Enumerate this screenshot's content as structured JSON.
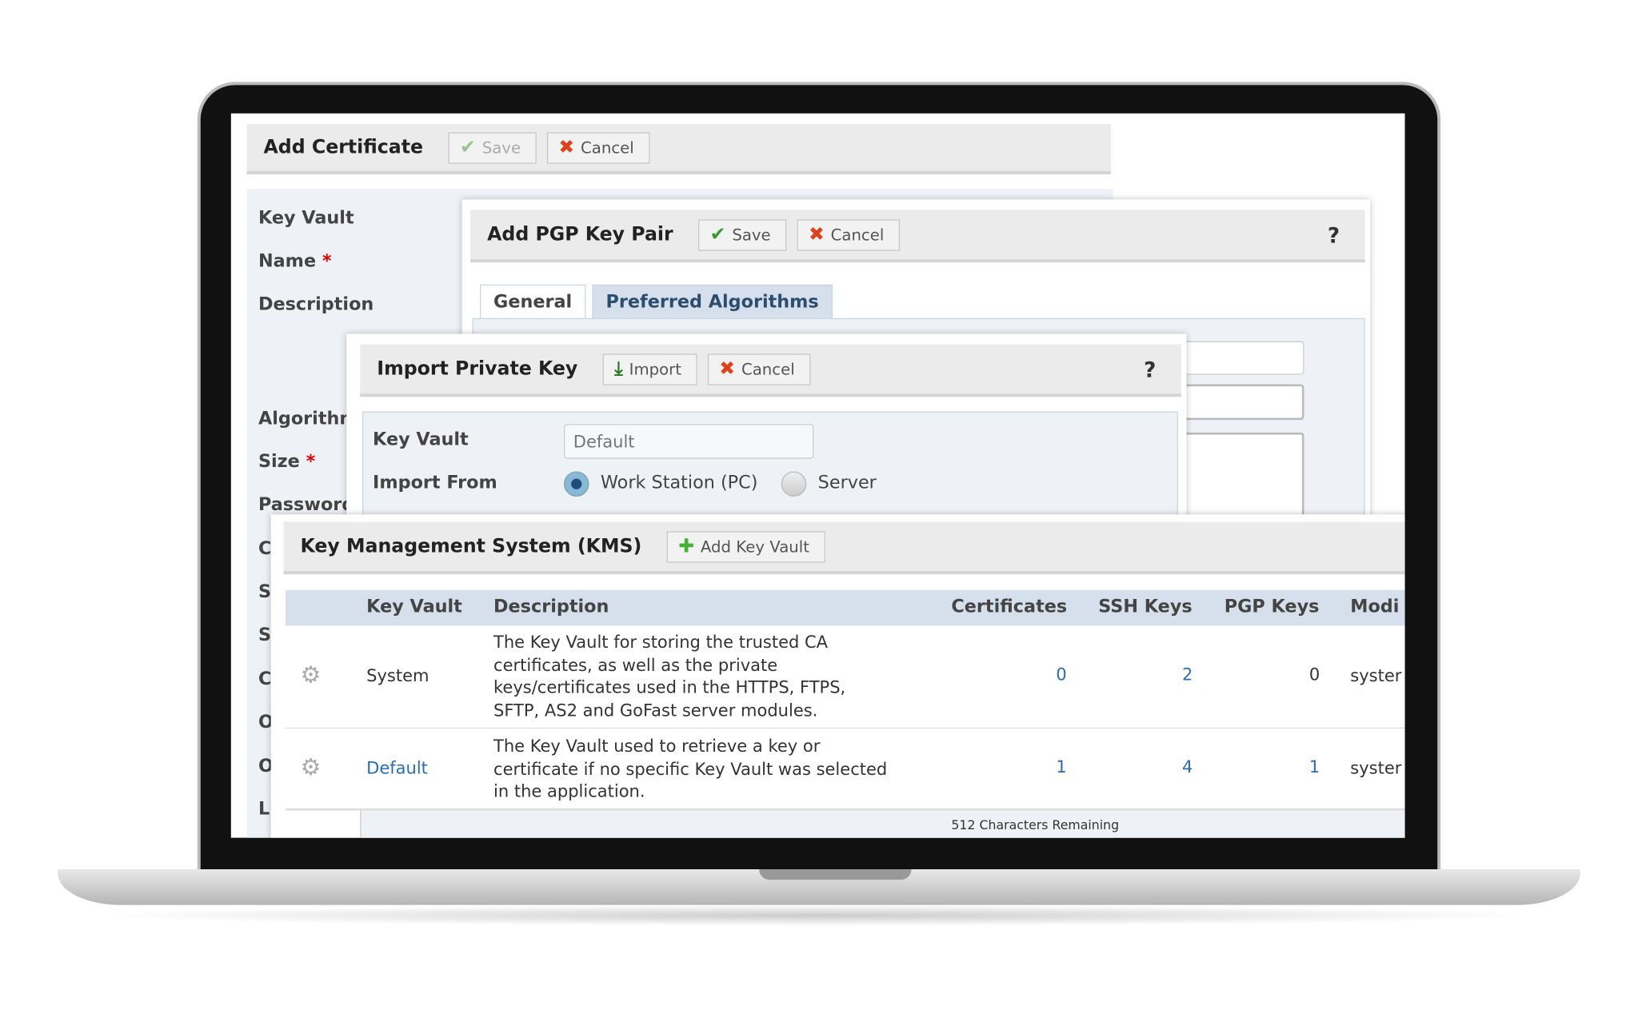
{
  "add_certificate": {
    "title": "Add Certificate",
    "save": "Save",
    "cancel": "Cancel",
    "labels": [
      "Key Vault",
      "Name",
      "Description",
      "Algorithm",
      "Size",
      "Password",
      "C",
      "S",
      "Si",
      "C",
      "O",
      "O",
      "L"
    ],
    "required_mark": "*"
  },
  "pgp": {
    "title": "Add PGP Key Pair",
    "save": "Save",
    "cancel": "Cancel",
    "help": "?",
    "tabs": [
      {
        "label": "General"
      },
      {
        "label": "Preferred Algorithms"
      }
    ]
  },
  "import_key": {
    "title": "Import Private Key",
    "import": "Import",
    "cancel": "Cancel",
    "help": "?",
    "key_vault_label": "Key Vault",
    "key_vault_placeholder": "Default",
    "import_from_label": "Import From",
    "options": [
      {
        "label": "Work Station (PC)",
        "selected": true
      },
      {
        "label": "Server",
        "selected": false
      }
    ]
  },
  "kms": {
    "title": "Key Management System (KMS)",
    "add_button": "Add Key Vault",
    "columns": [
      "Key Vault",
      "Description",
      "Certificates",
      "SSH Keys",
      "PGP Keys",
      "Modi"
    ],
    "rows": [
      {
        "name": "System",
        "link": false,
        "description": [
          "The Key Vault for storing the trusted CA",
          "certificates, as well as the private",
          "keys/certificates used in the HTTPS, FTPS,",
          "SFTP, AS2 and GoFast server modules."
        ],
        "certificates": "0",
        "ssh": "2",
        "pgp": "0",
        "modified": "syster"
      },
      {
        "name": "Default",
        "link": true,
        "description": [
          "The Key Vault used to retrieve a key or",
          "certificate if no specific Key Vault was selected",
          "in the application."
        ],
        "certificates": "1",
        "ssh": "4",
        "pgp": "1",
        "modified": "syster"
      }
    ],
    "footer_note": "512 Characters Remaining"
  },
  "colors": {
    "accent": "#2a6db5",
    "header_bg": "#ebebeb",
    "table_header": "#d6e0ec",
    "form_bg": "#eef2f7"
  }
}
